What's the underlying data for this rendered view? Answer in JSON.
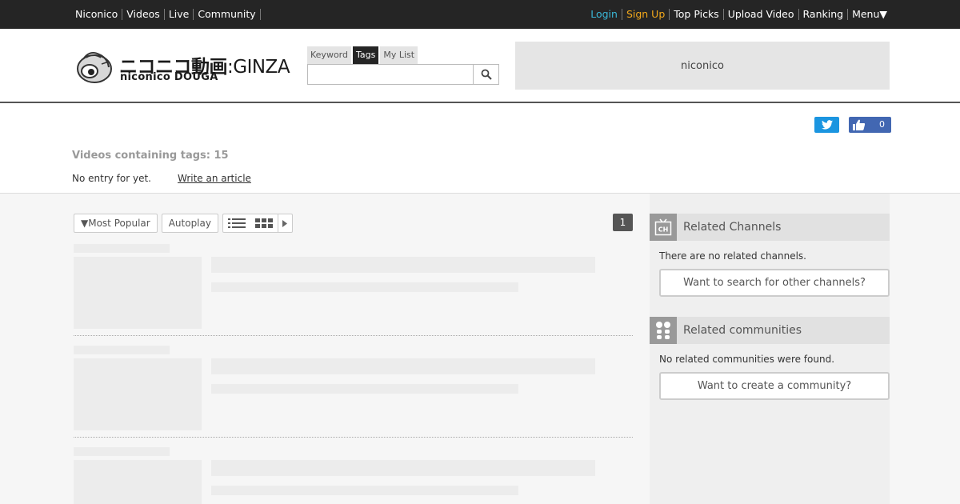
{
  "topbar": {
    "left_links": [
      "Niconico",
      "Videos",
      "Live",
      "Community"
    ],
    "login": "Login",
    "signup": "Sign Up",
    "right_links": [
      "Top Picks",
      "Upload Video",
      "Ranking",
      "Menu▼"
    ]
  },
  "logo": {
    "jp": "ニコニコ動画",
    "ginza": ":GINZA",
    "en": "niconico DOUGA"
  },
  "search": {
    "tabs": [
      "Keyword",
      "Tags",
      "My List"
    ],
    "active_tab": "Tags",
    "value": ""
  },
  "banner": {
    "text": "niconico"
  },
  "social": {
    "like_count": "0"
  },
  "tag_info": {
    "video_count": "Videos containing tags: 15",
    "no_entry": "No entry for  yet.",
    "write_article": "Write an article"
  },
  "toolbar": {
    "sort": "▼Most Popular",
    "autoplay": "Autoplay",
    "page": "1"
  },
  "sidebar": {
    "channels": {
      "title": "Related Channels",
      "empty": "There are no related channels.",
      "button": "Want to search for other channels?"
    },
    "communities": {
      "title": "Related communities",
      "empty": "No related communities were found.",
      "button": "Want to create a community?"
    }
  },
  "colors": {
    "topbar_bg": "#252525",
    "login": "#3ab8d8",
    "signup": "#f3a81b",
    "twitter": "#1b95e0",
    "facebook": "#4267b2"
  }
}
